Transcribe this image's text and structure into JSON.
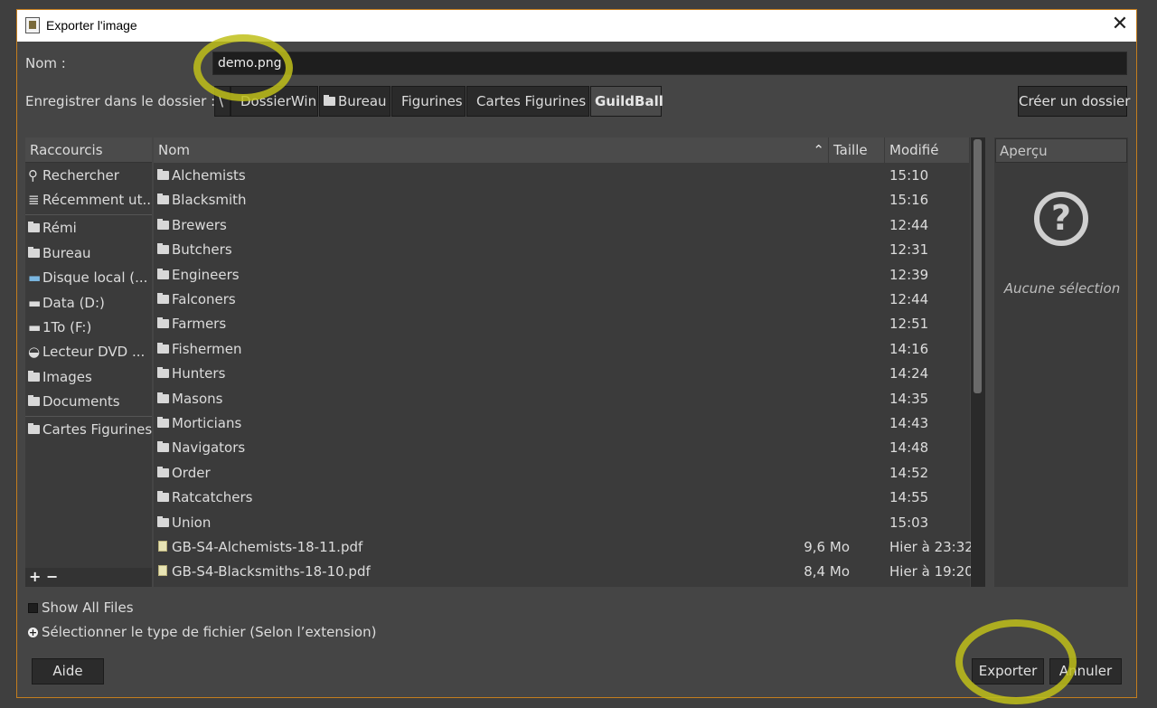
{
  "window": {
    "title": "Exporter l'image",
    "close_glyph": "✕"
  },
  "name_field": {
    "label": "Nom :",
    "value": "demo.png"
  },
  "save_in": {
    "label": "Enregistrer dans le dossier :",
    "root": "\\",
    "crumbs": [
      "DossierWin",
      "Bureau",
      "Figurines",
      "Cartes Figurines",
      "GuildBall"
    ],
    "create_folder": "Créer un dossier"
  },
  "places": {
    "header": "Raccourcis",
    "items": [
      "Rechercher",
      "Récemment ut...",
      "Rémi",
      "Bureau",
      "Disque local (...",
      "Data (D:)",
      "1To (F:)",
      "Lecteur DVD ...",
      "Images",
      "Documents",
      "Cartes Figurines"
    ],
    "add": "+",
    "remove": "−"
  },
  "files": {
    "col_name": "Nom",
    "col_size": "Taille",
    "col_modified": "Modifié",
    "sort_glyph": "⌃",
    "rows": [
      {
        "name": "Alchemists",
        "size": "",
        "modified": "15:10",
        "type": "folder"
      },
      {
        "name": "Blacksmith",
        "size": "",
        "modified": "15:16",
        "type": "folder"
      },
      {
        "name": "Brewers",
        "size": "",
        "modified": "12:44",
        "type": "folder"
      },
      {
        "name": "Butchers",
        "size": "",
        "modified": "12:31",
        "type": "folder"
      },
      {
        "name": "Engineers",
        "size": "",
        "modified": "12:39",
        "type": "folder"
      },
      {
        "name": "Falconers",
        "size": "",
        "modified": "12:44",
        "type": "folder"
      },
      {
        "name": "Farmers",
        "size": "",
        "modified": "12:51",
        "type": "folder"
      },
      {
        "name": "Fishermen",
        "size": "",
        "modified": "14:16",
        "type": "folder"
      },
      {
        "name": "Hunters",
        "size": "",
        "modified": "14:24",
        "type": "folder"
      },
      {
        "name": "Masons",
        "size": "",
        "modified": "14:35",
        "type": "folder"
      },
      {
        "name": "Morticians",
        "size": "",
        "modified": "14:43",
        "type": "folder"
      },
      {
        "name": "Navigators",
        "size": "",
        "modified": "14:48",
        "type": "folder"
      },
      {
        "name": "Order",
        "size": "",
        "modified": "14:52",
        "type": "folder"
      },
      {
        "name": "Ratcatchers",
        "size": "",
        "modified": "14:55",
        "type": "folder"
      },
      {
        "name": "Union",
        "size": "",
        "modified": "15:03",
        "type": "folder"
      },
      {
        "name": "GB-S4-Alchemists-18-11.pdf",
        "size": "9,6 Mo",
        "modified": "Hier à 23:32",
        "type": "pdf"
      },
      {
        "name": "GB-S4-Blacksmiths-18-10.pdf",
        "size": "8,4 Mo",
        "modified": "Hier à 19:20",
        "type": "pdf"
      }
    ]
  },
  "preview": {
    "header": "Aperçu",
    "icon": "?",
    "empty_text": "Aucune sélection"
  },
  "options": {
    "show_all_files": "Show All Files",
    "file_type": "Sélectionner le type de fichier (Selon l’extension)",
    "expander": "+"
  },
  "buttons": {
    "help": "Aide",
    "export": "Exporter",
    "cancel": "Annuler"
  },
  "colors": {
    "accent_border": "#c47d1e",
    "highlight": "#bfbf1a",
    "background": "#454545"
  }
}
